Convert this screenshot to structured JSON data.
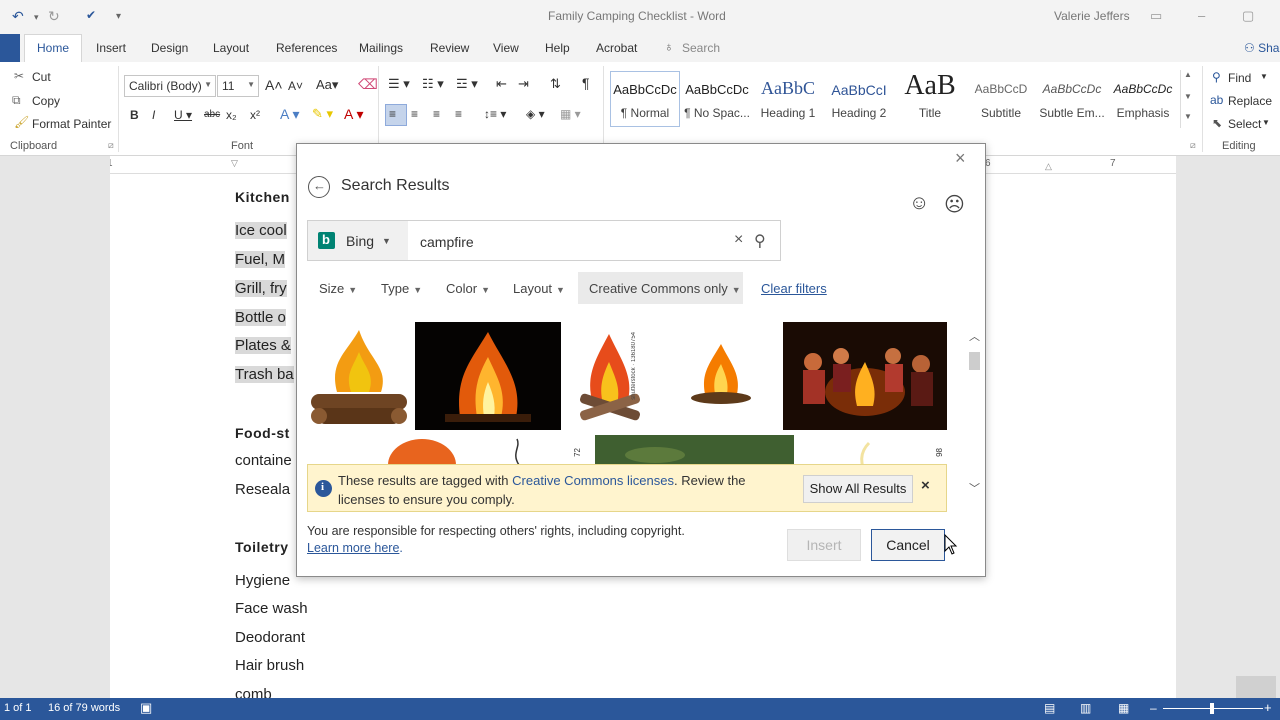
{
  "app": {
    "title": "Family Camping Checklist - Word",
    "user": "Valerie Jeffers"
  },
  "tabs": [
    "Home",
    "Insert",
    "Design",
    "Layout",
    "References",
    "Mailings",
    "Review",
    "View",
    "Help",
    "Acrobat"
  ],
  "tell_me": "Search",
  "share": "Sha",
  "ribbon": {
    "clipboard": {
      "cut": "Cut",
      "copy": "Copy",
      "format_painter": "Format Painter",
      "label": "Clipboard"
    },
    "font": {
      "name": "Calibri (Body)",
      "size": "11",
      "label": "Font"
    },
    "styles": [
      {
        "preview": "AaBbCcDc",
        "name": "¶ Normal"
      },
      {
        "preview": "AaBbCcDc",
        "name": "¶ No Spac..."
      },
      {
        "preview": "AaBbC",
        "name": "Heading 1"
      },
      {
        "preview": "AaBbCcI",
        "name": "Heading 2"
      },
      {
        "preview": "AaB",
        "name": "Title"
      },
      {
        "preview": "AaBbCcD",
        "name": "Subtitle"
      },
      {
        "preview": "AaBbCcDc",
        "name": "Subtle Em..."
      },
      {
        "preview": "AaBbCcDc",
        "name": "Emphasis"
      }
    ],
    "editing": {
      "find": "Find",
      "replace": "Replace",
      "select": "Select",
      "label": "Editing"
    }
  },
  "ruler": {
    "tick1": "1",
    "tick6": "6",
    "tick7": "7"
  },
  "document": {
    "heading_kitchen": "Kitchen",
    "kitchen_items": [
      "Ice cool",
      "Fuel, M",
      "Grill, fry",
      "Bottle o",
      "Plates &",
      "Trash ba"
    ],
    "heading_food": "Food-st",
    "food_items": [
      "containe",
      "Reseala"
    ],
    "heading_toiletries": "Toiletry",
    "toiletry_items": [
      "Hygiene",
      "Face wash",
      "Deodorant",
      "Hair brush",
      "comb"
    ]
  },
  "status": {
    "page": "1 of 1",
    "words": "16 of 79 words"
  },
  "dialog": {
    "title": "Search Results",
    "provider": "Bing",
    "query": "campfire",
    "filters": [
      "Size",
      "Type",
      "Color",
      "Layout"
    ],
    "cc_filter": "Creative Commons only",
    "clear_filters": "Clear filters",
    "banner": {
      "text_before": "These results are tagged with ",
      "link": "Creative Commons licenses",
      "text_after": ". Review the licenses to ensure you comply.",
      "show_all": "Show All Results"
    },
    "rights_text": "You are responsible for respecting others' rights, including copyright.",
    "learn_more": "Learn more here",
    "insert": "Insert",
    "cancel": "Cancel",
    "watermark_a": "shutterstock · 136180754",
    "watermark_b": "72",
    "watermark_c": "98"
  },
  "colors": {
    "accent": "#2b579a",
    "banner": "#fff4ce",
    "link": "#2b579a"
  }
}
